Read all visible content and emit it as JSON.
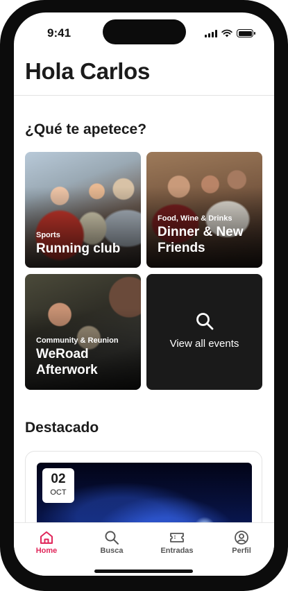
{
  "status_bar": {
    "time": "9:41"
  },
  "header": {
    "greeting": "Hola Carlos"
  },
  "explore": {
    "title": "¿Qué te apetece?",
    "tiles": [
      {
        "category": "Sports",
        "title_lines": [
          "Running club"
        ]
      },
      {
        "category": "Food, Wine & Drinks",
        "title_lines": [
          "Dinner & New",
          "Friends"
        ]
      },
      {
        "category": "Community & Reunion",
        "title_lines": [
          "WeRoad",
          "Afterwork"
        ]
      }
    ],
    "view_all": {
      "label": "View all events",
      "icon": "search-icon"
    }
  },
  "featured": {
    "title": "Destacado",
    "event": {
      "date_day": "02",
      "date_month": "OCT"
    }
  },
  "tab_bar": {
    "active": "Home",
    "accent_color": "#e0265a",
    "items": [
      {
        "label": "Home",
        "icon": "home-icon"
      },
      {
        "label": "Busca",
        "icon": "search-icon"
      },
      {
        "label": "Entradas",
        "icon": "ticket-icon"
      },
      {
        "label": "Perfil",
        "icon": "profile-icon"
      }
    ]
  }
}
